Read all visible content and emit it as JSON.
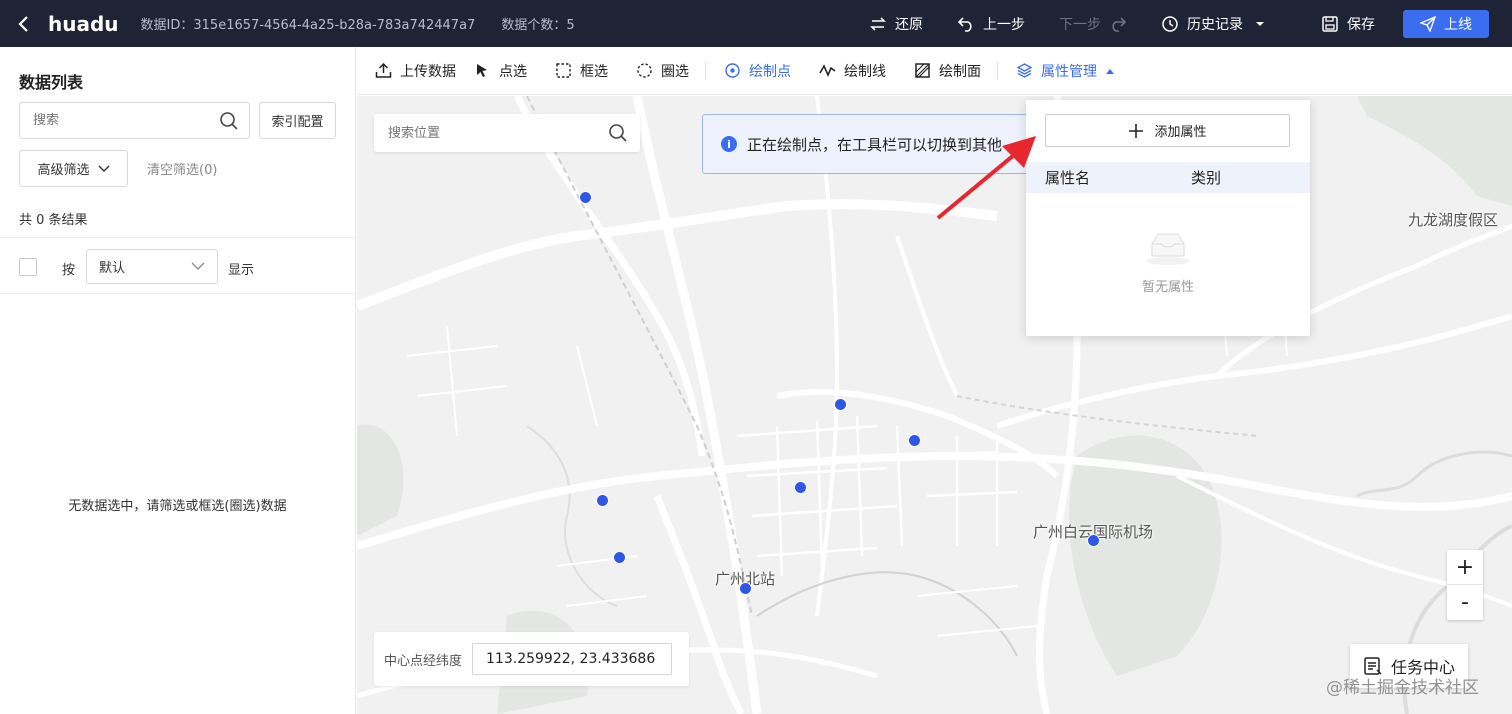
{
  "header": {
    "title": "huadu",
    "data_id_label": "数据ID：",
    "data_id": "315e1657-4564-4a25-b28a-783a742447a7",
    "count_label": "数据个数：",
    "count": "5",
    "undo_all": "还原",
    "prev_step": "上一步",
    "next_step": "下一步",
    "history": "历史记录",
    "save": "保存",
    "publish": "上线"
  },
  "sidebar": {
    "title": "数据列表",
    "search_placeholder": "搜索",
    "index_config": "索引配置",
    "advanced_filter": "高级筛选",
    "clear_filter": "清空筛选(0)",
    "result_count": "共 0 条结果",
    "sort_prefix": "按",
    "sort_value": "默认",
    "sort_suffix": "显示",
    "empty_note": "无数据选中，请筛选或框选(圈选)数据"
  },
  "toolbar": {
    "upload": "上传数据",
    "point_select": "点选",
    "box_select": "框选",
    "circle_select": "圈选",
    "draw_point": "绘制点",
    "draw_line": "绘制线",
    "draw_polygon": "绘制面",
    "attr_manage": "属性管理"
  },
  "map": {
    "search_placeholder": "搜索位置",
    "notice": "正在绘制点，在工具栏可以切换到其他",
    "labels": {
      "jiulong": "九龙湖度假区",
      "airport": "广州白云国际机场",
      "north_station": "广州北站"
    },
    "zoom_in": "+",
    "zoom_out": "-",
    "center_label": "中心点经纬度",
    "center_value": "113.259922, 23.433686",
    "task_center": "任务中心",
    "watermark": "@稀土掘金技术社区"
  },
  "attr_popup": {
    "add_attr": "添加属性",
    "col_name": "属性名",
    "col_type": "类别",
    "empty": "暂无属性"
  },
  "colors": {
    "header_bg": "#1f2336",
    "accent": "#3a6df0",
    "point": "#2f57e6",
    "arrow": "#e8262d"
  }
}
